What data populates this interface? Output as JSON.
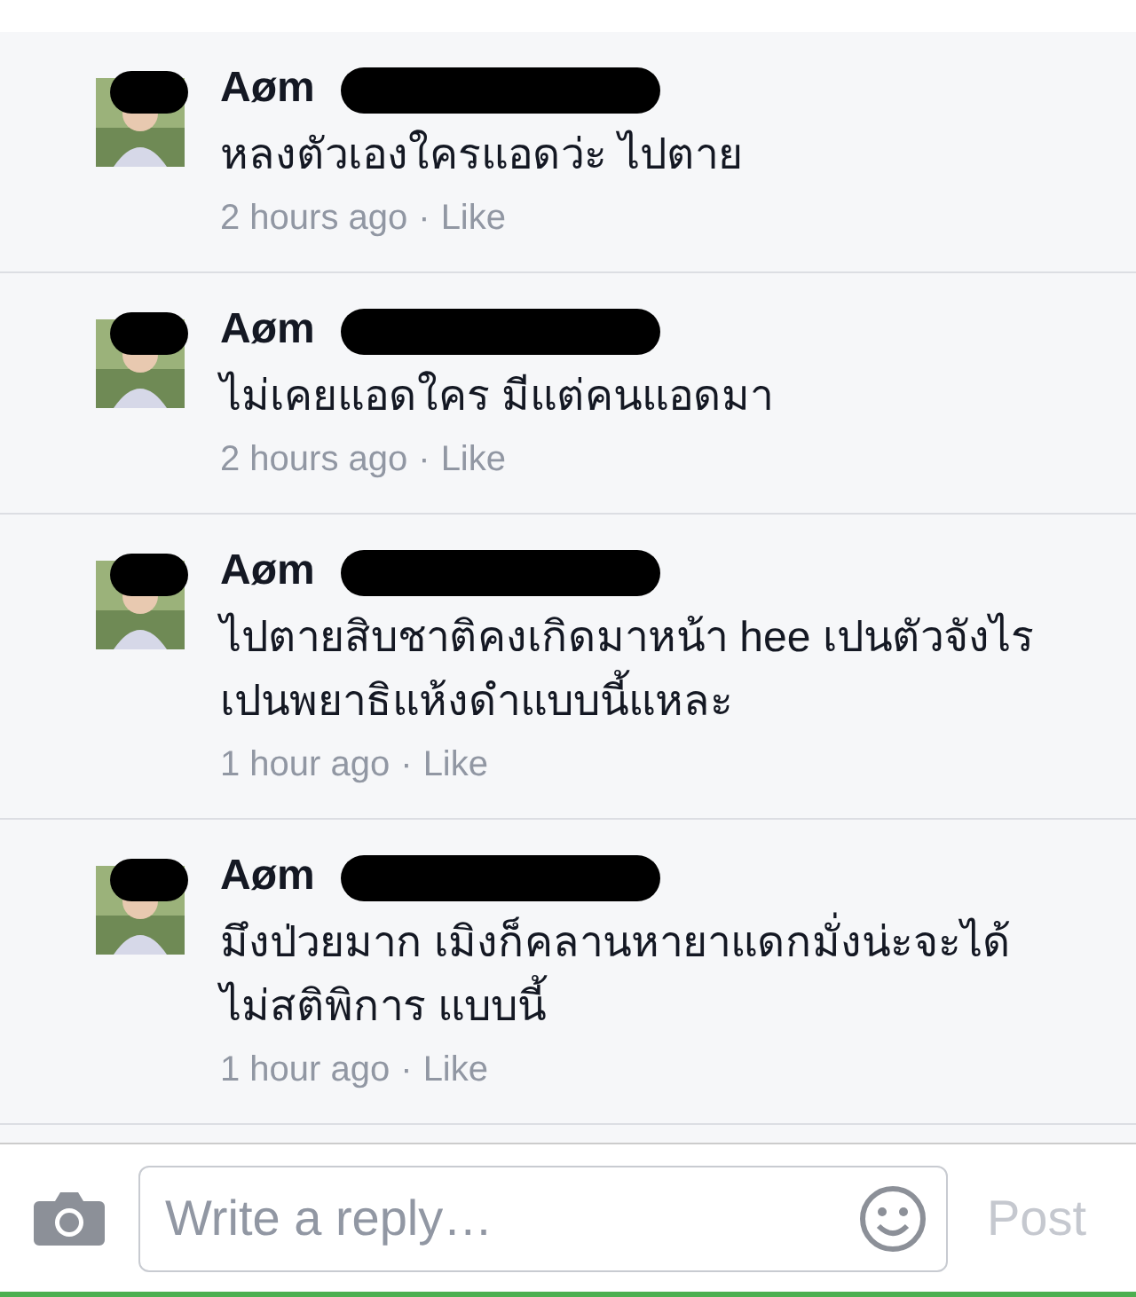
{
  "comments": [
    {
      "author": "Aøm",
      "text": "หลงตัวเองใครแอดว่ะ ไปตาย",
      "time": "2 hours ago",
      "action": "Like",
      "redacted": true
    },
    {
      "author": "Aøm",
      "text": "ไม่เคยแอดใคร มีแต่คนแอดมา",
      "time": "2 hours ago",
      "action": "Like",
      "redacted": true
    },
    {
      "author": "Aøm",
      "text": "ไปตายสิบชาติคงเกิดมาหน้า hee เปนตัวจังไร เปนพยาธิแห้งดำแบบนี้แหละ",
      "time": "1 hour ago",
      "action": "Like",
      "redacted": true
    },
    {
      "author": "Aøm",
      "text": "มึงป่วยมาก เมิงก็คลานหายาแดกมั่งน่ะจะได้ไม่สติพิการ แบบนี้",
      "time": "1 hour ago",
      "action": "Like",
      "redacted": true
    }
  ],
  "separator": "·",
  "reply_bar": {
    "placeholder": "Write a reply…",
    "post": {
      "label": "Post",
      "disabled": true
    }
  }
}
